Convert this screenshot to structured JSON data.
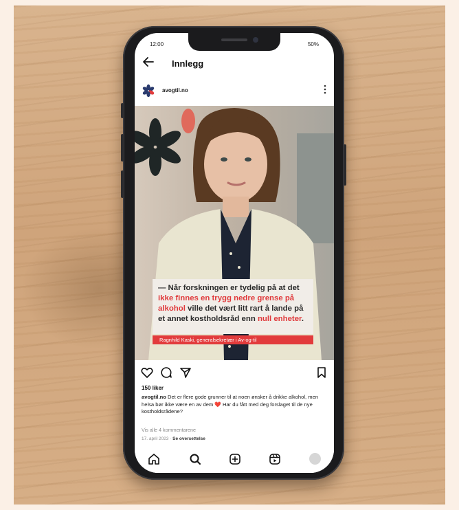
{
  "status_bar": {
    "time": "12:00",
    "battery": "50%"
  },
  "nav": {
    "title": "Innlegg"
  },
  "post": {
    "account": "avogtil.no",
    "quote": {
      "part1": "— Når forskningen er tydelig på at det ",
      "highlight1": "ikke finnes en trygg nedre grense på alkohol",
      "part2": " ville det vært litt rart å lande på et annet kostholdsråd enn ",
      "highlight2": "null enheter",
      "part3": "."
    },
    "credit": "Ragnhild Kaski, generalsekretær i Av-og-til",
    "likes": "150 liker",
    "caption_text": " Det er flere gode grunner til at noen ønsker å drikke alkohol, men helsa bør ikke være en av dem ",
    "caption_emoji": "❤️",
    "caption_text_end": " Har du fått med deg forslaget til de nye kostholdsrådene?",
    "view_comments": "Vis alle 4 kommentarene",
    "date": "17. april 2023",
    "translate": "Se oversettelse"
  },
  "colors": {
    "accent_red": "#e23b3c",
    "background": "#fbf0e6"
  },
  "icons": [
    "back-arrow-icon",
    "more-icon",
    "heart-icon",
    "comment-icon",
    "share-icon",
    "bookmark-icon",
    "home-icon",
    "search-icon",
    "add-post-icon",
    "reels-icon",
    "profile-icon"
  ]
}
